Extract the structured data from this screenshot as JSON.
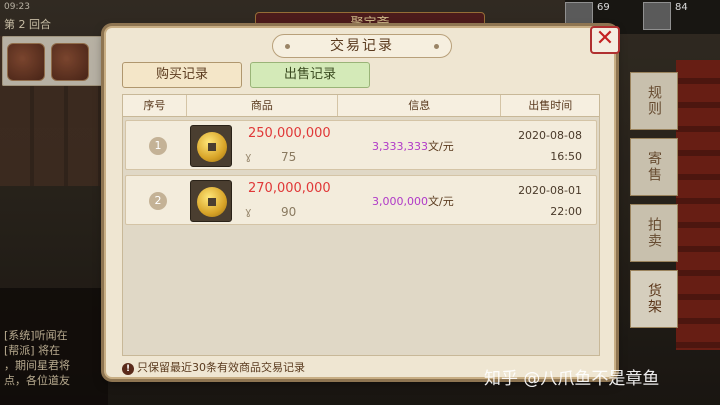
{
  "background": {
    "status_time": "09:23",
    "round_text": "第 2 回合",
    "top_title": "聚宝斋",
    "chat_lines": [
      "[系统]听闻在",
      "[帮派] 将在",
      "，期间星君将",
      "点，各位道友"
    ],
    "top_right_numbers": [
      "69",
      "84"
    ]
  },
  "side_tabs": [
    {
      "label": "规则"
    },
    {
      "label": "寄售"
    },
    {
      "label": "拍卖"
    },
    {
      "label": "货架"
    }
  ],
  "modal": {
    "title": "交易记录",
    "close_label": "✕",
    "tabs": {
      "buy": "购买记录",
      "sell": "出售记录"
    },
    "columns": [
      "序号",
      "商品",
      "信息",
      "出售时间"
    ],
    "rows": [
      {
        "index": "1",
        "price": "250,000,000",
        "rank": "ɣ",
        "qty": "75",
        "unit_num": "3,333,333",
        "unit_suffix": "文/元",
        "date": "2020-08-08",
        "time": "16:50"
      },
      {
        "index": "2",
        "price": "270,000,000",
        "rank": "ɣ",
        "qty": "90",
        "unit_num": "3,000,000",
        "unit_suffix": "文/元",
        "date": "2020-08-01",
        "time": "22:00"
      }
    ],
    "footnote": "只保留最近30条有效商品交易记录",
    "footnote_icon": "!"
  },
  "watermark": "知乎 @八爪鱼不是章鱼"
}
